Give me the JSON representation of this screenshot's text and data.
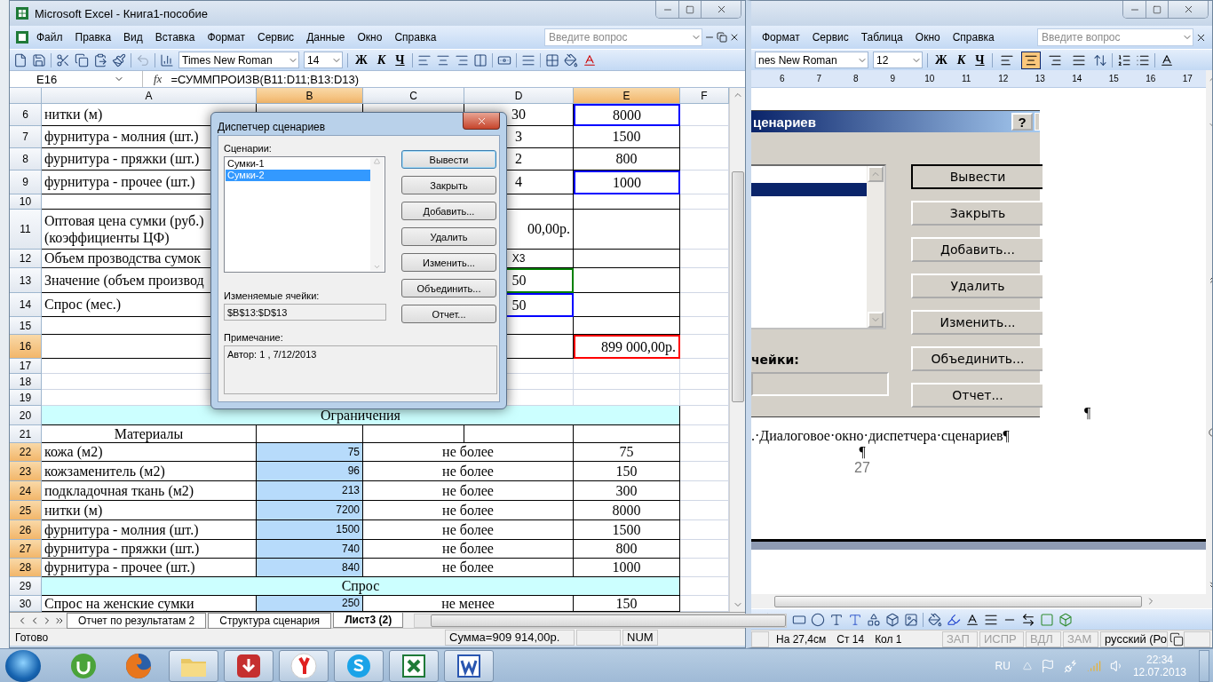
{
  "excel": {
    "title": "Microsoft Excel - Книга1-пособие",
    "menu": [
      "Файл",
      "Правка",
      "Вид",
      "Вставка",
      "Формат",
      "Сервис",
      "Данные",
      "Окно",
      "Справка"
    ],
    "help": {
      "placeholder": "Введите вопрос"
    },
    "font": "Times New Roman",
    "size": "14",
    "style_buttons": [
      "Ж",
      "К",
      "Ч"
    ],
    "name_box": "E16",
    "fx": "fx",
    "formula": "=СУММПРОИЗВ(B11:D11;B13:D13)",
    "columns": [
      {
        "label": "A",
        "selected": false
      },
      {
        "label": "B",
        "selected": true
      },
      {
        "label": "C",
        "selected": false
      },
      {
        "label": "D",
        "selected": false
      },
      {
        "label": "E",
        "selected": true
      },
      {
        "label": "F",
        "selected": false
      }
    ],
    "rows": [
      {
        "header": "6",
        "selected": false,
        "kind": "data",
        "a": {
          "text": "нитки (м)"
        },
        "d": {
          "text": "30"
        },
        "e": {
          "text": "8000",
          "color": "#0000ff"
        }
      },
      {
        "header": "7",
        "selected": false,
        "kind": "data",
        "a": {
          "text": "фурнитура - молния (шт.)"
        },
        "d": {
          "text": "3"
        },
        "e": {
          "text": "1500"
        }
      },
      {
        "header": "8",
        "selected": false,
        "kind": "data",
        "a": {
          "text": "фурнитура - пряжки (шт.)"
        },
        "d": {
          "text": "2"
        },
        "e": {
          "text": "800"
        }
      },
      {
        "header": "9",
        "selected": false,
        "kind": "data",
        "a": {
          "text": "фурнитура - прочее (шт.)"
        },
        "d": {
          "text": "4"
        },
        "e": {
          "text": "1000",
          "color": "#0000ff"
        }
      },
      {
        "header": "10",
        "selected": false,
        "kind": "data"
      },
      {
        "header": "11",
        "selected": false,
        "kind": "data",
        "a": {
          "text": "Оптовая цена сумки (руб.)\n(коэффициенты ЦФ)"
        },
        "d": {
          "text": "00,00р.",
          "kind": "currency"
        }
      },
      {
        "header": "12",
        "selected": false,
        "kind": "data",
        "a": {
          "text": "Объем прозводства сумок"
        },
        "d": {
          "text": "X3",
          "kind": "sans"
        }
      },
      {
        "header": "13",
        "selected": false,
        "kind": "data",
        "a": {
          "text": "Значение (объем производ"
        },
        "d": {
          "text": "50",
          "color": "#008000"
        }
      },
      {
        "header": "14",
        "selected": false,
        "kind": "data",
        "a": {
          "text": "Спрос (мес.)"
        },
        "d": {
          "text": "50",
          "color": "#0000ff"
        }
      },
      {
        "header": "15",
        "selected": false,
        "kind": "data"
      },
      {
        "header": "16",
        "selected": true,
        "kind": "data",
        "e": {
          "text": "899 000,00р.",
          "kind": "currency",
          "color": "#ff0000"
        }
      },
      {
        "header": "17",
        "selected": false,
        "kind": "blank"
      },
      {
        "header": "18",
        "selected": false,
        "kind": "blank"
      },
      {
        "header": "19",
        "selected": false,
        "kind": "blank"
      },
      {
        "header": "20",
        "selected": false,
        "kind": "section",
        "title": "Ограничения"
      },
      {
        "header": "21",
        "selected": false,
        "kind": "data",
        "a": {
          "text": "Материалы",
          "kind": "center"
        }
      },
      {
        "header": "22",
        "selected": true,
        "kind": "constraint",
        "a": "кожа (м2)",
        "b": "75",
        "cd": "не более",
        "e": "75"
      },
      {
        "header": "23",
        "selected": true,
        "kind": "constraint",
        "a": "кожзаменитель (м2)",
        "b": "96",
        "cd": "не более",
        "e": "150"
      },
      {
        "header": "24",
        "selected": true,
        "kind": "constraint",
        "a": "подкладочная ткань (м2)",
        "b": "213",
        "cd": "не более",
        "e": "300"
      },
      {
        "header": "25",
        "selected": true,
        "kind": "constraint",
        "a": "нитки (м)",
        "b": "7200",
        "cd": "не более",
        "e": "8000"
      },
      {
        "header": "26",
        "selected": true,
        "kind": "constraint",
        "a": "фурнитура - молния (шт.)",
        "b": "1500",
        "cd": "не более",
        "e": "1500"
      },
      {
        "header": "27",
        "selected": true,
        "kind": "constraint",
        "a": "фурнитура - пряжки (шт.)",
        "b": "740",
        "cd": "не более",
        "e": "800"
      },
      {
        "header": "28",
        "selected": true,
        "kind": "constraint",
        "a": "фурнитура - прочее (шт.)",
        "b": "840",
        "cd": "не более",
        "e": "1000"
      },
      {
        "header": "29",
        "selected": false,
        "kind": "section",
        "title": "Спрос"
      },
      {
        "header": "30",
        "selected": false,
        "kind": "constraint",
        "a": "Спрос на женские сумки",
        "b": "250",
        "cd": "не менее",
        "e": "150"
      }
    ],
    "sheet_tabs": [
      {
        "label": "Отчет по результатам 2",
        "selected": false
      },
      {
        "label": "Структура сценария",
        "selected": false
      },
      {
        "label": "Лист3 (2)",
        "selected": true
      }
    ],
    "status": "Готово",
    "sum": "Сумма=909 914,00р.",
    "num": "NUM"
  },
  "dialog": {
    "title": "Диспетчер сценариев",
    "list_label": "Сценарии:",
    "scenarios": [
      {
        "label": "Сумки-1",
        "selected": false
      },
      {
        "label": "Сумки-2",
        "selected": true
      }
    ],
    "buttons": [
      {
        "label": "Вывести",
        "default": true
      },
      {
        "label": "Закрыть",
        "default": false
      },
      {
        "label": "Добавить...",
        "default": false
      },
      {
        "label": "Удалить",
        "default": false
      },
      {
        "label": "Изменить...",
        "default": false
      },
      {
        "label": "Объединить...",
        "default": false
      },
      {
        "label": "Отчет...",
        "default": false
      }
    ],
    "cells_label": "Изменяемые ячейки:",
    "cells_value": "$B$13:$D$13",
    "note_label": "Примечание:",
    "note": "Автор: 1 , 7/12/2013"
  },
  "word": {
    "menu": [
      "Формат",
      "Сервис",
      "Таблица",
      "Окно",
      "Справка"
    ],
    "help": {
      "placeholder": "Введите вопрос"
    },
    "font": "nes New Roman",
    "size": "12",
    "style_buttons": [
      "Ж",
      "К",
      "Ч"
    ],
    "align": [
      {
        "kind": "left",
        "selected": false
      },
      {
        "kind": "center",
        "selected": true
      },
      {
        "kind": "right",
        "selected": false
      },
      {
        "kind": "justify",
        "selected": false
      }
    ],
    "ruler": [
      "6",
      "7",
      "8",
      "9",
      "10",
      "11",
      "12",
      "13",
      "14",
      "15",
      "16",
      "17"
    ],
    "figure": {
      "title": "ценариев",
      "help": "?",
      "list": [
        {
          "selected": true
        }
      ],
      "buttons": [
        "Вывести",
        "Закрыть",
        "Добавить...",
        "Удалить",
        "Изменить...",
        "Объединить...",
        "Отчет..."
      ],
      "cells_label": "чейки:"
    },
    "caption": ".·Диалоговое·окно·диспетчера·сценариев¶",
    "side_mark": "¶",
    "center_mark": "¶",
    "page_number": "27",
    "status": [
      "На 27,4см",
      "Ст 14",
      "Кол 1"
    ],
    "modes": [
      {
        "label": "ЗАП",
        "on": false
      },
      {
        "label": "ИСПР",
        "on": false
      },
      {
        "label": "ВДЛ",
        "on": false
      },
      {
        "label": "ЗАМ",
        "on": false
      }
    ],
    "language": "русский (Ро"
  },
  "taskbar": {
    "apps": [
      {
        "kind": "torrent",
        "active": false
      },
      {
        "kind": "browser",
        "active": false
      },
      {
        "kind": "folder",
        "active": true
      },
      {
        "kind": "download",
        "active": true
      },
      {
        "kind": "yandex",
        "active": true
      },
      {
        "kind": "skype",
        "active": true
      },
      {
        "kind": "excel",
        "active": true
      },
      {
        "kind": "word",
        "active": true
      }
    ],
    "language": "RU",
    "time": "22:34",
    "date": "12.07.2013"
  }
}
